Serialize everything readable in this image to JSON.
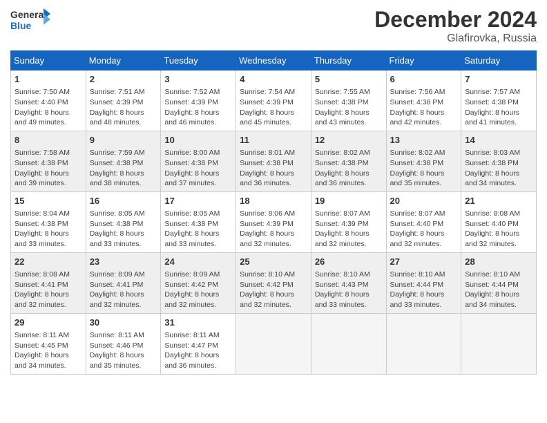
{
  "header": {
    "logo_general": "General",
    "logo_blue": "Blue",
    "month_title": "December 2024",
    "location": "Glafirovka, Russia"
  },
  "days_of_week": [
    "Sunday",
    "Monday",
    "Tuesday",
    "Wednesday",
    "Thursday",
    "Friday",
    "Saturday"
  ],
  "weeks": [
    [
      {
        "day": 1,
        "info": "Sunrise: 7:50 AM\nSunset: 4:40 PM\nDaylight: 8 hours\nand 49 minutes."
      },
      {
        "day": 2,
        "info": "Sunrise: 7:51 AM\nSunset: 4:39 PM\nDaylight: 8 hours\nand 48 minutes."
      },
      {
        "day": 3,
        "info": "Sunrise: 7:52 AM\nSunset: 4:39 PM\nDaylight: 8 hours\nand 46 minutes."
      },
      {
        "day": 4,
        "info": "Sunrise: 7:54 AM\nSunset: 4:39 PM\nDaylight: 8 hours\nand 45 minutes."
      },
      {
        "day": 5,
        "info": "Sunrise: 7:55 AM\nSunset: 4:38 PM\nDaylight: 8 hours\nand 43 minutes."
      },
      {
        "day": 6,
        "info": "Sunrise: 7:56 AM\nSunset: 4:38 PM\nDaylight: 8 hours\nand 42 minutes."
      },
      {
        "day": 7,
        "info": "Sunrise: 7:57 AM\nSunset: 4:38 PM\nDaylight: 8 hours\nand 41 minutes."
      }
    ],
    [
      {
        "day": 8,
        "info": "Sunrise: 7:58 AM\nSunset: 4:38 PM\nDaylight: 8 hours\nand 39 minutes."
      },
      {
        "day": 9,
        "info": "Sunrise: 7:59 AM\nSunset: 4:38 PM\nDaylight: 8 hours\nand 38 minutes."
      },
      {
        "day": 10,
        "info": "Sunrise: 8:00 AM\nSunset: 4:38 PM\nDaylight: 8 hours\nand 37 minutes."
      },
      {
        "day": 11,
        "info": "Sunrise: 8:01 AM\nSunset: 4:38 PM\nDaylight: 8 hours\nand 36 minutes."
      },
      {
        "day": 12,
        "info": "Sunrise: 8:02 AM\nSunset: 4:38 PM\nDaylight: 8 hours\nand 36 minutes."
      },
      {
        "day": 13,
        "info": "Sunrise: 8:02 AM\nSunset: 4:38 PM\nDaylight: 8 hours\nand 35 minutes."
      },
      {
        "day": 14,
        "info": "Sunrise: 8:03 AM\nSunset: 4:38 PM\nDaylight: 8 hours\nand 34 minutes."
      }
    ],
    [
      {
        "day": 15,
        "info": "Sunrise: 8:04 AM\nSunset: 4:38 PM\nDaylight: 8 hours\nand 33 minutes."
      },
      {
        "day": 16,
        "info": "Sunrise: 8:05 AM\nSunset: 4:38 PM\nDaylight: 8 hours\nand 33 minutes."
      },
      {
        "day": 17,
        "info": "Sunrise: 8:05 AM\nSunset: 4:38 PM\nDaylight: 8 hours\nand 33 minutes."
      },
      {
        "day": 18,
        "info": "Sunrise: 8:06 AM\nSunset: 4:39 PM\nDaylight: 8 hours\nand 32 minutes."
      },
      {
        "day": 19,
        "info": "Sunrise: 8:07 AM\nSunset: 4:39 PM\nDaylight: 8 hours\nand 32 minutes."
      },
      {
        "day": 20,
        "info": "Sunrise: 8:07 AM\nSunset: 4:40 PM\nDaylight: 8 hours\nand 32 minutes."
      },
      {
        "day": 21,
        "info": "Sunrise: 8:08 AM\nSunset: 4:40 PM\nDaylight: 8 hours\nand 32 minutes."
      }
    ],
    [
      {
        "day": 22,
        "info": "Sunrise: 8:08 AM\nSunset: 4:41 PM\nDaylight: 8 hours\nand 32 minutes."
      },
      {
        "day": 23,
        "info": "Sunrise: 8:09 AM\nSunset: 4:41 PM\nDaylight: 8 hours\nand 32 minutes."
      },
      {
        "day": 24,
        "info": "Sunrise: 8:09 AM\nSunset: 4:42 PM\nDaylight: 8 hours\nand 32 minutes."
      },
      {
        "day": 25,
        "info": "Sunrise: 8:10 AM\nSunset: 4:42 PM\nDaylight: 8 hours\nand 32 minutes."
      },
      {
        "day": 26,
        "info": "Sunrise: 8:10 AM\nSunset: 4:43 PM\nDaylight: 8 hours\nand 33 minutes."
      },
      {
        "day": 27,
        "info": "Sunrise: 8:10 AM\nSunset: 4:44 PM\nDaylight: 8 hours\nand 33 minutes."
      },
      {
        "day": 28,
        "info": "Sunrise: 8:10 AM\nSunset: 4:44 PM\nDaylight: 8 hours\nand 34 minutes."
      }
    ],
    [
      {
        "day": 29,
        "info": "Sunrise: 8:11 AM\nSunset: 4:45 PM\nDaylight: 8 hours\nand 34 minutes."
      },
      {
        "day": 30,
        "info": "Sunrise: 8:11 AM\nSunset: 4:46 PM\nDaylight: 8 hours\nand 35 minutes."
      },
      {
        "day": 31,
        "info": "Sunrise: 8:11 AM\nSunset: 4:47 PM\nDaylight: 8 hours\nand 36 minutes."
      },
      null,
      null,
      null,
      null
    ]
  ]
}
